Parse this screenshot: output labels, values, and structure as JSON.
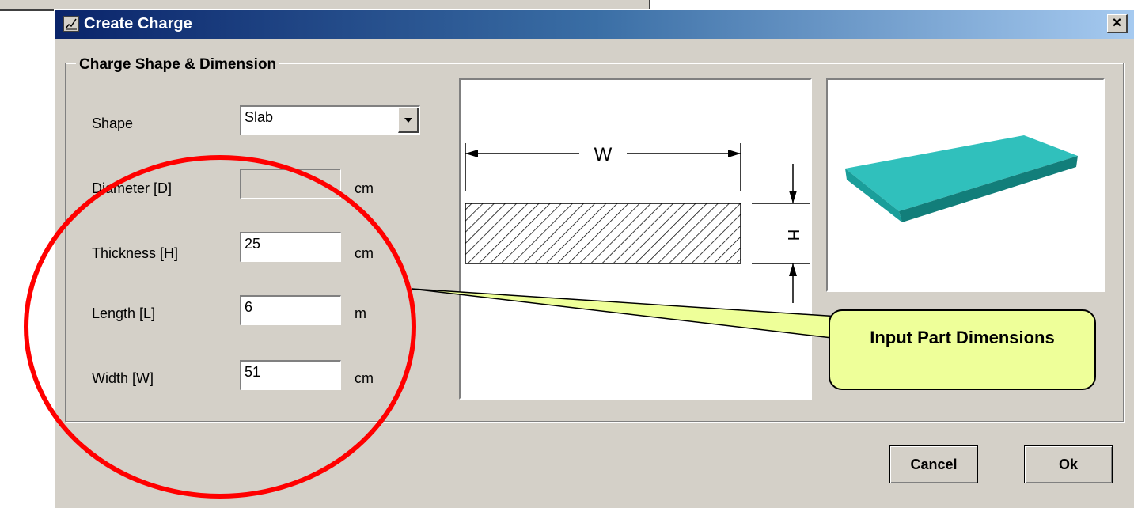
{
  "dialog": {
    "title": "Create Charge",
    "close_glyph": "×"
  },
  "group": {
    "legend": "Charge Shape & Dimension"
  },
  "form": {
    "shape_label": "Shape",
    "shape_value": "Slab",
    "diameter_label": "Diameter [D]",
    "diameter_value": "",
    "diameter_unit": "cm",
    "thickness_label": "Thickness [H]",
    "thickness_value": "25",
    "thickness_unit": "cm",
    "length_label": "Length [L]",
    "length_value": "6",
    "length_unit": "m",
    "width_label": "Width [W]",
    "width_value": "51",
    "width_unit": "cm"
  },
  "diagram": {
    "width_label": "W",
    "height_label": "H"
  },
  "buttons": {
    "cancel": "Cancel",
    "ok": "Ok"
  },
  "annotation": {
    "callout_text": "Input Part Dimensions",
    "colors": {
      "callout_fill": "#eeff99",
      "ellipse": "#ff0000",
      "slab": "#20b2aa"
    }
  }
}
